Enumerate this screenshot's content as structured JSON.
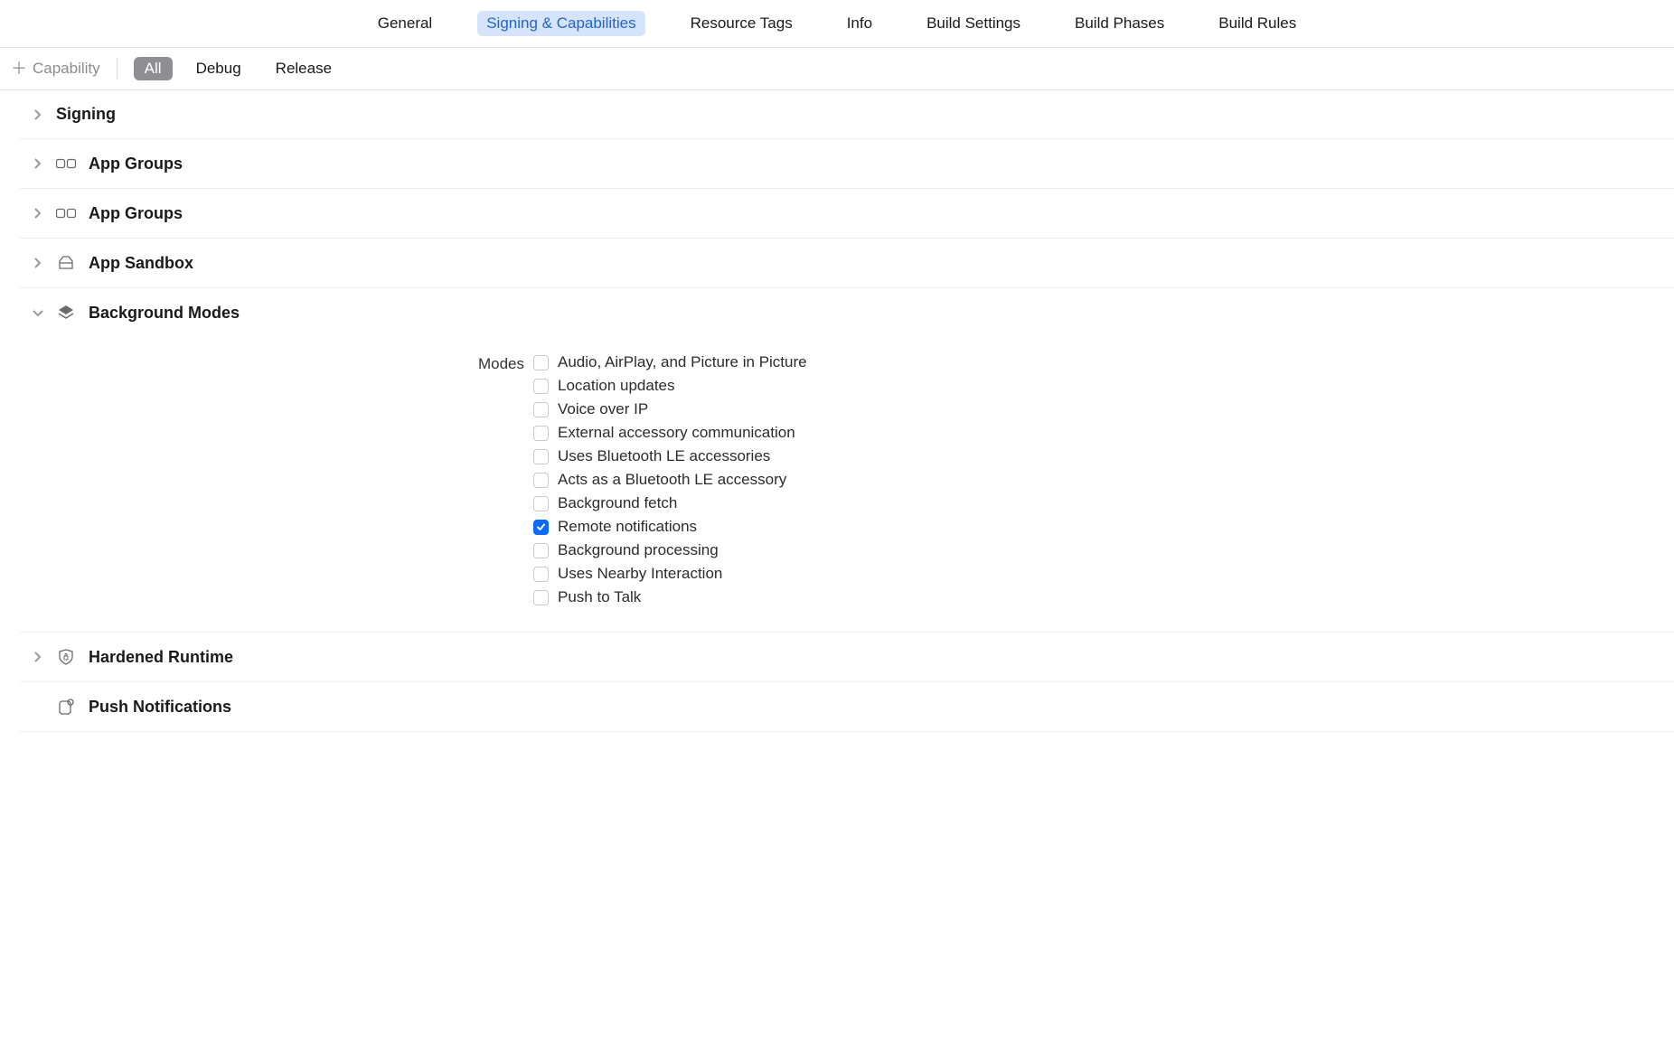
{
  "tabs": {
    "general": "General",
    "signing": "Signing & Capabilities",
    "resource_tags": "Resource Tags",
    "info": "Info",
    "build_settings": "Build Settings",
    "build_phases": "Build Phases",
    "build_rules": "Build Rules",
    "active": "signing"
  },
  "subbar": {
    "add_capability": "Capability",
    "filters": {
      "all": "All",
      "debug": "Debug",
      "release": "Release",
      "active": "all"
    }
  },
  "sections": {
    "signing": {
      "title": "Signing",
      "expanded": false
    },
    "app_groups_1": {
      "title": "App Groups",
      "expanded": false
    },
    "app_groups_2": {
      "title": "App Groups",
      "expanded": false
    },
    "app_sandbox": {
      "title": "App Sandbox",
      "expanded": false
    },
    "background_modes": {
      "title": "Background Modes",
      "expanded": true,
      "modes_label": "Modes",
      "modes": [
        {
          "label": "Audio, AirPlay, and Picture in Picture",
          "checked": false
        },
        {
          "label": "Location updates",
          "checked": false
        },
        {
          "label": "Voice over IP",
          "checked": false
        },
        {
          "label": "External accessory communication",
          "checked": false
        },
        {
          "label": "Uses Bluetooth LE accessories",
          "checked": false
        },
        {
          "label": "Acts as a Bluetooth LE accessory",
          "checked": false
        },
        {
          "label": "Background fetch",
          "checked": false
        },
        {
          "label": "Remote notifications",
          "checked": true
        },
        {
          "label": "Background processing",
          "checked": false
        },
        {
          "label": "Uses Nearby Interaction",
          "checked": false
        },
        {
          "label": "Push to Talk",
          "checked": false
        }
      ]
    },
    "hardened_runtime": {
      "title": "Hardened Runtime",
      "expanded": false
    },
    "push_notifications": {
      "title": "Push Notifications",
      "expanded": false
    }
  }
}
